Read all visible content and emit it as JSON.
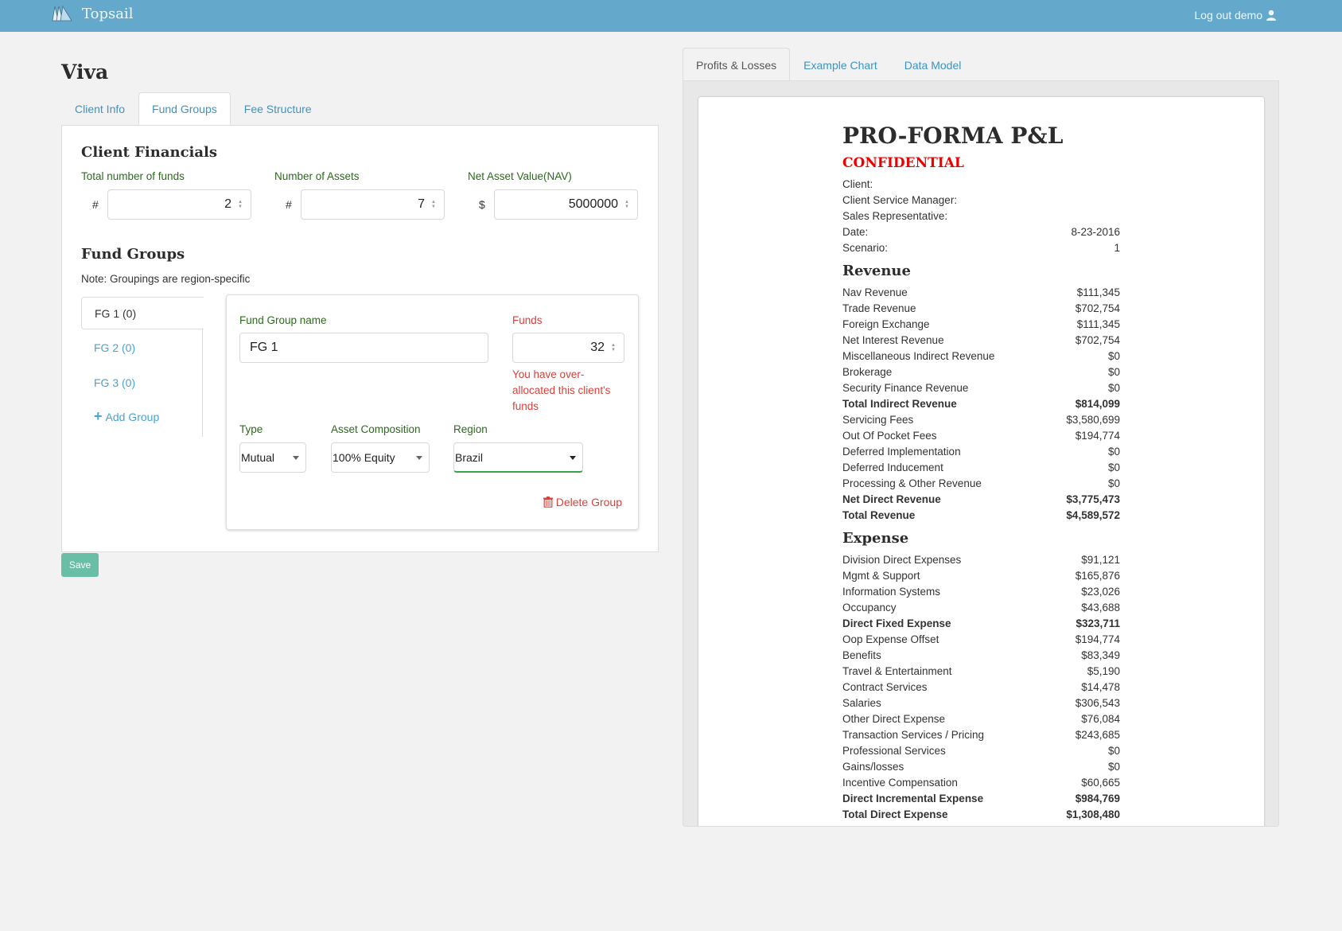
{
  "app": {
    "brand": "Topsail",
    "logout_label": "Log out demo",
    "icons": {
      "logo": "sails-logo-icon",
      "user": "user-icon"
    }
  },
  "client": {
    "name": "Viva",
    "tabs": [
      {
        "label": "Client Info",
        "active": false
      },
      {
        "label": "Fund Groups",
        "active": true
      },
      {
        "label": "Fee Structure",
        "active": false
      }
    ]
  },
  "financials": {
    "title": "Client Financials",
    "total_funds": {
      "label": "Total number of funds",
      "prefix": "#",
      "value": "2"
    },
    "num_assets": {
      "label": "Number of Assets",
      "prefix": "#",
      "value": "7"
    },
    "nav": {
      "label": "Net Asset Value(NAV)",
      "prefix": "$",
      "value": "5000000"
    }
  },
  "fund_groups": {
    "title": "Fund Groups",
    "note": "Note: Groupings are region-specific",
    "items": [
      {
        "label": "FG 1 (0)",
        "active": true
      },
      {
        "label": "FG 2 (0)",
        "active": false
      },
      {
        "label": "FG 3 (0)",
        "active": false
      }
    ],
    "add_label": "Add Group",
    "editor": {
      "name_label": "Fund Group name",
      "name_value": "FG 1",
      "funds_label": "Funds",
      "funds_value": "32",
      "funds_error": "You have over-allocated this client's funds",
      "type_label": "Type",
      "type_value": "Mutual",
      "composition_label": "Asset Composition",
      "composition_value": "100% Equity",
      "region_label": "Region",
      "region_value": "Brazil",
      "delete_label": "Delete Group"
    }
  },
  "save_label": "Save",
  "right_tabs": [
    {
      "label": "Profits & Losses",
      "active": true
    },
    {
      "label": "Example Chart",
      "active": false
    },
    {
      "label": "Data Model",
      "active": false
    }
  ],
  "report": {
    "title": "PRO-FORMA P&L",
    "confidential": "CONFIDENTIAL",
    "meta": [
      {
        "label": "Client:",
        "value": ""
      },
      {
        "label": "Client Service Manager:",
        "value": ""
      },
      {
        "label": "Sales Representative:",
        "value": ""
      },
      {
        "label": "Date:",
        "value": "8-23-2016"
      },
      {
        "label": "Scenario:",
        "value": "1"
      }
    ],
    "revenue_title": "Revenue",
    "revenue": [
      {
        "label": "Nav Revenue",
        "value": "$111,345",
        "bold": false
      },
      {
        "label": "Trade Revenue",
        "value": "$702,754",
        "bold": false
      },
      {
        "label": "Foreign Exchange",
        "value": "$111,345",
        "bold": false
      },
      {
        "label": "Net Interest Revenue",
        "value": "$702,754",
        "bold": false
      },
      {
        "label": "Miscellaneous Indirect Revenue",
        "value": "$0",
        "bold": false
      },
      {
        "label": "Brokerage",
        "value": "$0",
        "bold": false
      },
      {
        "label": "Security Finance Revenue",
        "value": "$0",
        "bold": false
      },
      {
        "label": "Total Indirect Revenue",
        "value": "$814,099",
        "bold": true
      },
      {
        "label": "Servicing Fees",
        "value": "$3,580,699",
        "bold": false
      },
      {
        "label": "Out Of Pocket Fees",
        "value": "$194,774",
        "bold": false
      },
      {
        "label": "Deferred Implementation",
        "value": "$0",
        "bold": false
      },
      {
        "label": "Deferred Inducement",
        "value": "$0",
        "bold": false
      },
      {
        "label": "Processing & Other Revenue",
        "value": "$0",
        "bold": false
      },
      {
        "label": "Net Direct Revenue",
        "value": "$3,775,473",
        "bold": true
      },
      {
        "label": "Total Revenue",
        "value": "$4,589,572",
        "bold": true
      }
    ],
    "expense_title": "Expense",
    "expense": [
      {
        "label": "Division Direct Expenses",
        "value": "$91,121",
        "bold": false
      },
      {
        "label": "Mgmt & Support",
        "value": "$165,876",
        "bold": false
      },
      {
        "label": "Information Systems",
        "value": "$23,026",
        "bold": false
      },
      {
        "label": "Occupancy",
        "value": "$43,688",
        "bold": false
      },
      {
        "label": "Direct Fixed Expense",
        "value": "$323,711",
        "bold": true
      },
      {
        "label": "Oop Expense Offset",
        "value": "$194,774",
        "bold": false
      },
      {
        "label": "Benefits",
        "value": "$83,349",
        "bold": false
      },
      {
        "label": "Travel & Entertainment",
        "value": "$5,190",
        "bold": false
      },
      {
        "label": "Contract Services",
        "value": "$14,478",
        "bold": false
      },
      {
        "label": "Salaries",
        "value": "$306,543",
        "bold": false
      },
      {
        "label": "Other Direct Expense",
        "value": "$76,084",
        "bold": false
      },
      {
        "label": "Transaction Services / Pricing",
        "value": "$243,685",
        "bold": false
      },
      {
        "label": "Professional Services",
        "value": "$0",
        "bold": false
      },
      {
        "label": "Gains/losses",
        "value": "$0",
        "bold": false
      },
      {
        "label": "Incentive Compensation",
        "value": "$60,665",
        "bold": false
      },
      {
        "label": "Direct Incremental Expense",
        "value": "$984,769",
        "bold": true
      },
      {
        "label": "Total Direct Expense",
        "value": "$1,308,480",
        "bold": true
      }
    ]
  },
  "colors": {
    "topbar": "#64a9cc",
    "link": "#3c94c3",
    "label_green": "#2d6a1e",
    "error_red": "#d9413a",
    "confidential_red": "#ee0000",
    "save_button": "#68bfa6",
    "focus_green": "#3aa34a"
  }
}
